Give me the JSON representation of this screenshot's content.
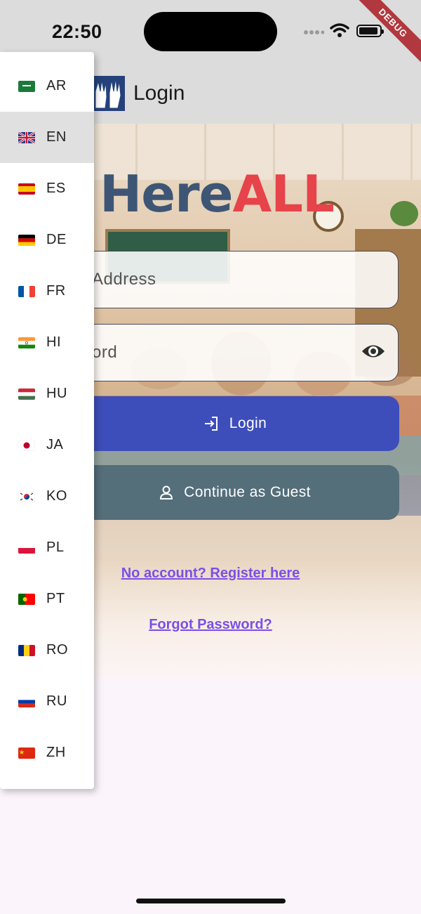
{
  "status": {
    "time": "22:50",
    "debug_label": "DEBUG"
  },
  "appbar": {
    "title": "Login"
  },
  "hero": {
    "title_part1": "Here",
    "title_part2": "ALL"
  },
  "form": {
    "email_placeholder": "Address",
    "password_placeholder": "ord",
    "login_label": "Login",
    "guest_label": "Continue as Guest",
    "register_link": "No account? Register here",
    "forgot_link": "Forgot Password?"
  },
  "language_menu": {
    "selected": "EN",
    "items": [
      {
        "code": "AR",
        "flag": "saudi-arabia-flag"
      },
      {
        "code": "EN",
        "flag": "uk-flag"
      },
      {
        "code": "ES",
        "flag": "spain-flag"
      },
      {
        "code": "DE",
        "flag": "germany-flag"
      },
      {
        "code": "FR",
        "flag": "france-flag"
      },
      {
        "code": "HI",
        "flag": "india-flag"
      },
      {
        "code": "HU",
        "flag": "hungary-flag"
      },
      {
        "code": "JA",
        "flag": "japan-flag"
      },
      {
        "code": "KO",
        "flag": "korea-flag"
      },
      {
        "code": "PL",
        "flag": "poland-flag"
      },
      {
        "code": "PT",
        "flag": "portugal-flag"
      },
      {
        "code": "RO",
        "flag": "romania-flag"
      },
      {
        "code": "RU",
        "flag": "russia-flag"
      },
      {
        "code": "ZH",
        "flag": "china-flag"
      }
    ]
  }
}
